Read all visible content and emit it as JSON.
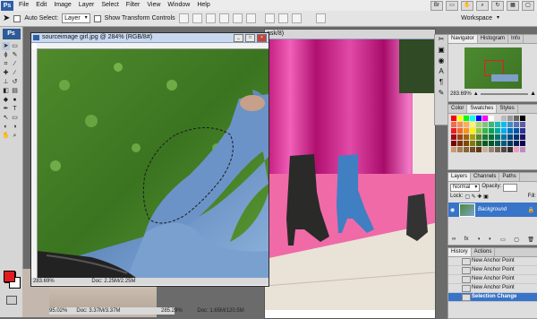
{
  "menu": [
    "File",
    "Edit",
    "Image",
    "Layer",
    "Select",
    "Filter",
    "View",
    "Window",
    "Help"
  ],
  "app_logo": "Ps",
  "options": {
    "auto_select_label": "Auto Select:",
    "auto_select_value": "Layer",
    "show_transform_label": "Show Transform Controls",
    "workspace_label": "Workspace"
  },
  "doc_front": {
    "title": "sourceimage girl.jpg @ 284% (RGB/8#)",
    "zoom": "283.69%",
    "doc_info": "Doc: 2.25M/2.25M"
  },
  "doc_back": {
    "title_fragment": "ask/8)",
    "zoom": "285.29%",
    "doc_info": "Doc: 1.65M/120.5M"
  },
  "doc_left": {
    "zoom": "95.02%",
    "doc_info": "Doc: 3.37M/3.37M"
  },
  "navigator": {
    "tabs": [
      "Navigator",
      "Histogram",
      "Info"
    ],
    "zoom": "283.69%"
  },
  "color_panel": {
    "tabs": [
      "Color",
      "Swatches",
      "Styles"
    ]
  },
  "layers_panel": {
    "tabs": [
      "Layers",
      "Channels",
      "Paths"
    ],
    "blend_mode": "Normal",
    "opacity_label": "Opacity:",
    "fill_label": "Fill:",
    "lock_label": "Lock:",
    "layer_name": "Background"
  },
  "history_panel": {
    "tabs": [
      "History",
      "Actions"
    ],
    "items": [
      "New Anchor Point",
      "New Anchor Point",
      "New Anchor Point",
      "New Anchor Point",
      "Selection Change"
    ]
  },
  "colors": {
    "foreground": "#e21b23",
    "background": "#ffffff",
    "selection": "#3874c8"
  }
}
